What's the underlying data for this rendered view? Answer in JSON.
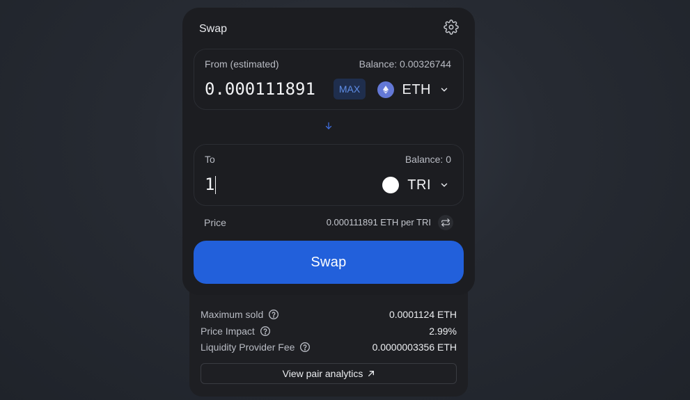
{
  "swap_card": {
    "title": "Swap",
    "settings_icon": "gear-icon",
    "from": {
      "label": "From (estimated)",
      "balance": "Balance: 0.00326744",
      "amount": "0.000111891",
      "max_label": "MAX",
      "token": {
        "symbol": "ETH",
        "icon": "ethereum-icon",
        "color": "#6378d6"
      }
    },
    "direction_icon": "arrow-down-icon",
    "to": {
      "label": "To",
      "balance": "Balance: 0",
      "amount": "1",
      "token": {
        "symbol": "TRI",
        "icon": "tri-token-icon",
        "color": "#ffffff"
      }
    },
    "price": {
      "label": "Price",
      "value": "0.000111891 ETH per TRI",
      "flip_icon": "swap-arrows-icon"
    },
    "swap_button_label": "Swap",
    "accent_color": "#2260db"
  },
  "details": {
    "rows": [
      {
        "label": "Maximum sold",
        "value": "0.0001124 ETH"
      },
      {
        "label": "Price Impact",
        "value": "2.99%"
      },
      {
        "label": "Liquidity Provider Fee",
        "value": "0.0000003356 ETH"
      }
    ],
    "analytics_label": "View pair analytics"
  }
}
